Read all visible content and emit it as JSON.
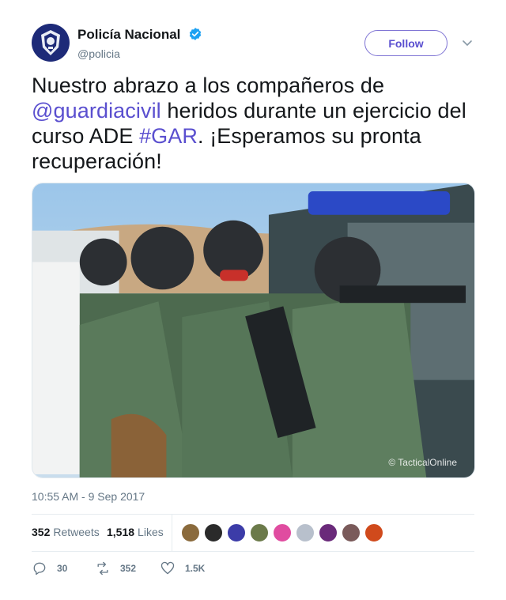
{
  "account": {
    "display_name": "Policía Nacional",
    "handle": "@policia",
    "verified": true,
    "follow_label": "Follow"
  },
  "tweet": {
    "text_before": "Nuestro abrazo a los compañeros de ",
    "mention": "@guardiacivil",
    "text_middle": " heridos durante un ejercicio del curso ADE ",
    "hashtag": "#GAR",
    "text_after": ". ¡Esperamos su pronta recuperación!",
    "image_watermark": "© TacticalOnline",
    "timestamp": "10:55 AM - 9 Sep 2017"
  },
  "stats": {
    "retweets_count": "352",
    "retweets_label": "Retweets",
    "likes_count": "1,518",
    "likes_label": "Likes",
    "liker_colors": [
      "#8a6a3c",
      "#2a2a2a",
      "#3c3ca8",
      "#6b7a4a",
      "#e04ca0",
      "#b8c0cc",
      "#6a2a7a",
      "#7a5a5a",
      "#d04a1c"
    ]
  },
  "actions": {
    "replies": "30",
    "retweets": "352",
    "likes": "1.5K"
  },
  "colors": {
    "link": "#5a4fcf",
    "secondary_text": "#657786",
    "verified": "#1da1f2"
  }
}
